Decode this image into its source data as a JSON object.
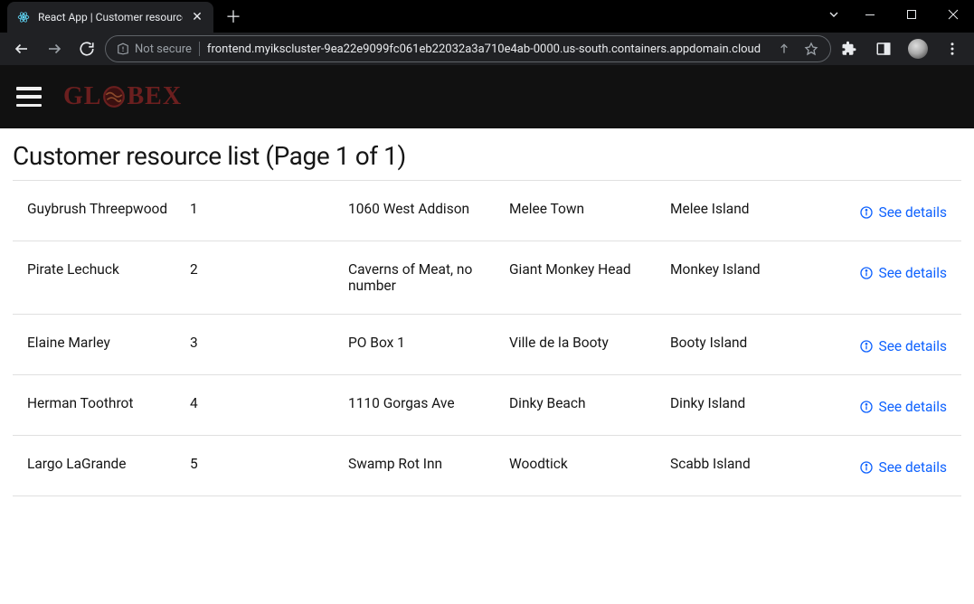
{
  "browser": {
    "tab_title": "React App | Customer resource li",
    "not_secure_label": "Not secure",
    "url": "frontend.myikscluster-9ea22e9099fc061eb22032a3a710e4ab-0000.us-south.containers.appdomain.cloud"
  },
  "header": {
    "logo_text_left": "GL",
    "logo_text_right": "BEX"
  },
  "page": {
    "title": "Customer resource list (Page 1 of 1)",
    "see_details_label": "See details"
  },
  "customers": [
    {
      "name": "Guybrush Threepwood",
      "id": "1",
      "address": "1060 West Addison",
      "city": "Melee Town",
      "region": "Melee Island"
    },
    {
      "name": "Pirate Lechuck",
      "id": "2",
      "address": "Caverns of Meat, no number",
      "city": "Giant Monkey Head",
      "region": "Monkey Island"
    },
    {
      "name": "Elaine Marley",
      "id": "3",
      "address": "PO Box 1",
      "city": "Ville de la Booty",
      "region": "Booty Island"
    },
    {
      "name": "Herman Toothrot",
      "id": "4",
      "address": "1110 Gorgas Ave",
      "city": "Dinky Beach",
      "region": "Dinky Island"
    },
    {
      "name": "Largo LaGrande",
      "id": "5",
      "address": "Swamp Rot Inn",
      "city": "Woodtick",
      "region": "Scabb Island"
    }
  ]
}
